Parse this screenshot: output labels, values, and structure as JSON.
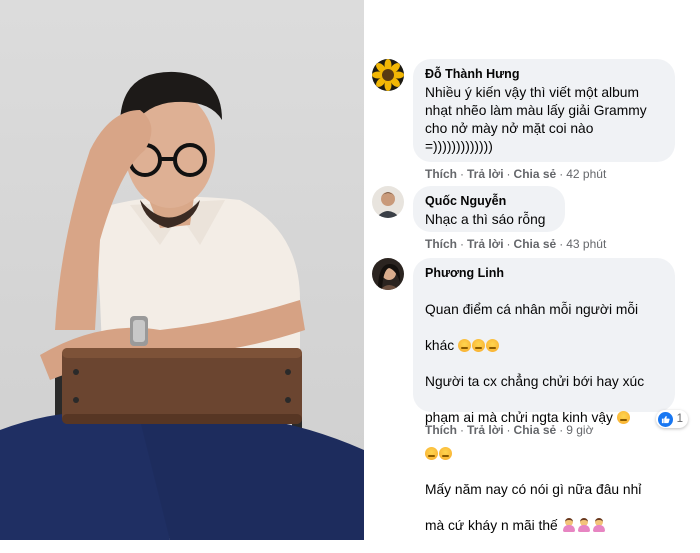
{
  "comments": [
    {
      "author": "Đỗ Thành Hưng",
      "text": "Nhiều ý kiến vậy thì viết một album\nnhạt nhẽo làm màu lấy giải Grammy\ncho nở mày nở mặt coi nào\n=)))))))))))))",
      "actions": {
        "like": "Thích",
        "reply": "Trả lời",
        "share": "Chia sẻ",
        "time": "42 phút"
      }
    },
    {
      "author": "Quốc Nguyễn",
      "text": "Nhạc a thì sáo rỗng",
      "actions": {
        "like": "Thích",
        "reply": "Trả lời",
        "share": "Chia sẻ",
        "time": "43 phút"
      }
    },
    {
      "author": "Phương Linh",
      "lines": [
        "Quan điểm cá nhân mỗi người mỗi",
        "khác",
        "Người ta cx chẳng chửi bới hay xúc",
        "phạm ai mà chửi ngta kinh vậy",
        "Mấy năm nay có nói gì nữa đâu nhỉ",
        "mà cứ kháy n mãi thế"
      ],
      "actions": {
        "like": "Thích",
        "reply": "Trả lời",
        "share": "Chia sẻ",
        "time": "9 giờ"
      },
      "reaction_count": "1"
    }
  ],
  "icons": {
    "reaction": "like-icon",
    "emoji": "pensive-face-emoji",
    "person_emoji": "person-gesturing-emoji"
  },
  "colors": {
    "bubble": "#f0f2f5",
    "like_blue": "#1877f2",
    "meta_gray": "#65676b"
  }
}
